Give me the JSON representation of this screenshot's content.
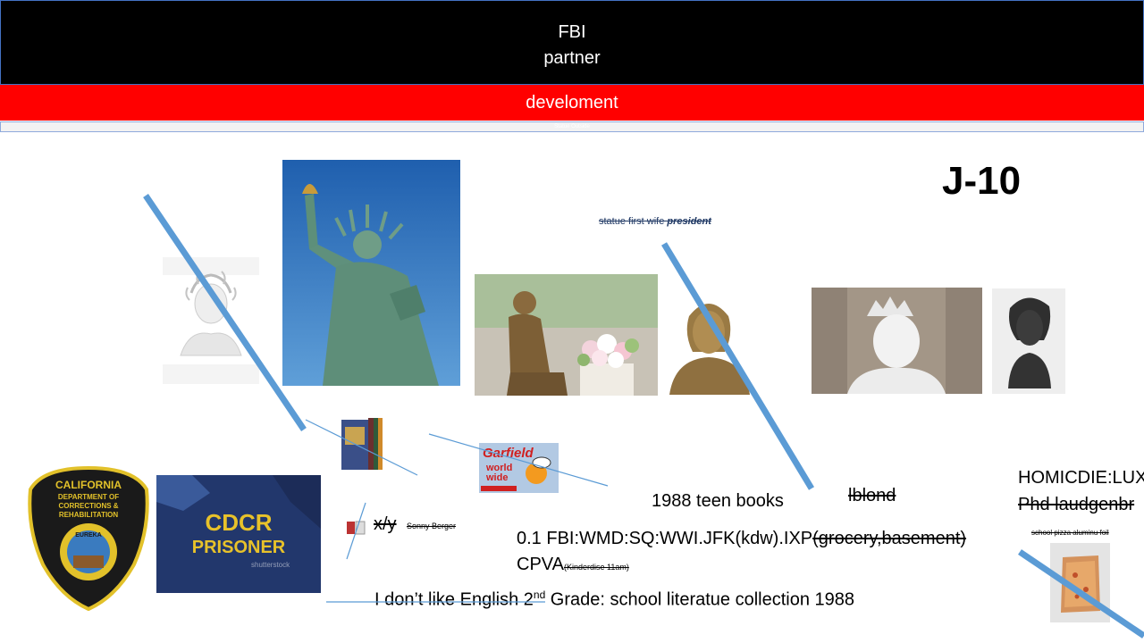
{
  "header": {
    "line1": "FBI",
    "line2": "partner"
  },
  "red_bar": {
    "label": "develoment"
  },
  "thin_bar": {
    "label": "Statue Outside"
  },
  "code": "J-10",
  "caption_statue": {
    "text": "statue first wife ",
    "emphasis": "president"
  },
  "garfield": {
    "title": "Garfield",
    "sub": "world wide"
  },
  "badge": {
    "top": "CALIFORNIA",
    "mid": "DEPARTMENT OF CORRECTIONS & REHABILITATION",
    "seal": "EUREKA"
  },
  "jacket": {
    "line1": "CDCR",
    "line2": "PRISONER",
    "watermark": "shutterstock"
  },
  "small_xy": "x/y",
  "small_name": "Sonny Berger",
  "teen_books": "1988 teen books",
  "blond": "lblond",
  "homicide": "HOMICDIE:LUX",
  "phd": "Phd laudgenbr",
  "school_pizza": "school pizza aluminu foil",
  "fbi_line": {
    "main": "0.1 FBI:WMD:SQ:WWI.JFK(kdw).IXP",
    "struck": "(grocery,basement)"
  },
  "cpva": {
    "main": "CPVA",
    "sub": "(Kinderdise 11am)"
  },
  "english": {
    "pre": "I don’t like English 2",
    "sup": "nd",
    "post": " Grade: school literatue collection 1988"
  },
  "colors": {
    "header_bg": "#000000",
    "red_bar": "#ff0000",
    "line_blue": "#5b9bd5",
    "sky": "#2f6fb8",
    "bronze": "#8a6a3e"
  }
}
